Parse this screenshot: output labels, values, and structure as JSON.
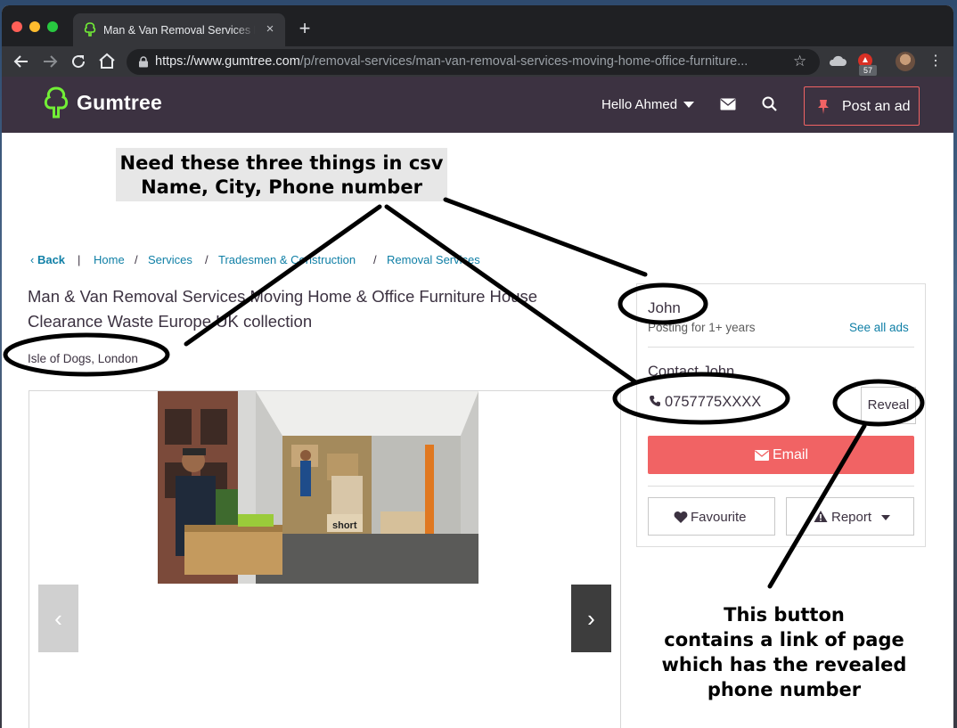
{
  "browser": {
    "tab_title": "Man & Van Removal Services M",
    "new_tab_symbol": "+",
    "close_symbol": "×",
    "url_host": "https://www.gumtree.com",
    "url_path": "/p/removal-services/man-van-removal-services-moving-home-office-furniture...",
    "extension_badge": "57"
  },
  "header": {
    "logo_text": "Gumtree",
    "greeting": "Hello Ahmed",
    "post_ad_label": "Post an ad"
  },
  "annotations": {
    "top_note": [
      "Need these three things in csv",
      "Name, City, Phone number"
    ],
    "bottom_note": [
      "This button",
      "contains a link of page",
      "which has the revealed",
      "phone number"
    ]
  },
  "breadcrumb": {
    "back": "Back",
    "separator_bar": "|",
    "separator": "/",
    "items": [
      "Home",
      "Services",
      "Tradesmen & Construction",
      "Removal Services"
    ]
  },
  "ad": {
    "title_line1": "Man & Van Removal Services Moving Home & Office Furniture House",
    "title_line2": "Clearance Waste Europe UK collection",
    "location": "Isle of Dogs, London",
    "photo_crate_text": "short",
    "prev_arrow": "‹",
    "next_arrow": "›"
  },
  "seller": {
    "name": "John",
    "posting_for": "Posting for 1+ years",
    "see_all_ads": "See all ads",
    "contact_label": "Contact John",
    "phone": "0757775XXXX",
    "reveal_label": "Reveal",
    "email_label": "Email",
    "favourite_label": "Favourite",
    "report_label": "Report"
  },
  "colors": {
    "header_bg": "#3c3241",
    "brand_green": "#72ef36",
    "accent_red": "#f16364",
    "link_blue": "#0f7fa6"
  }
}
